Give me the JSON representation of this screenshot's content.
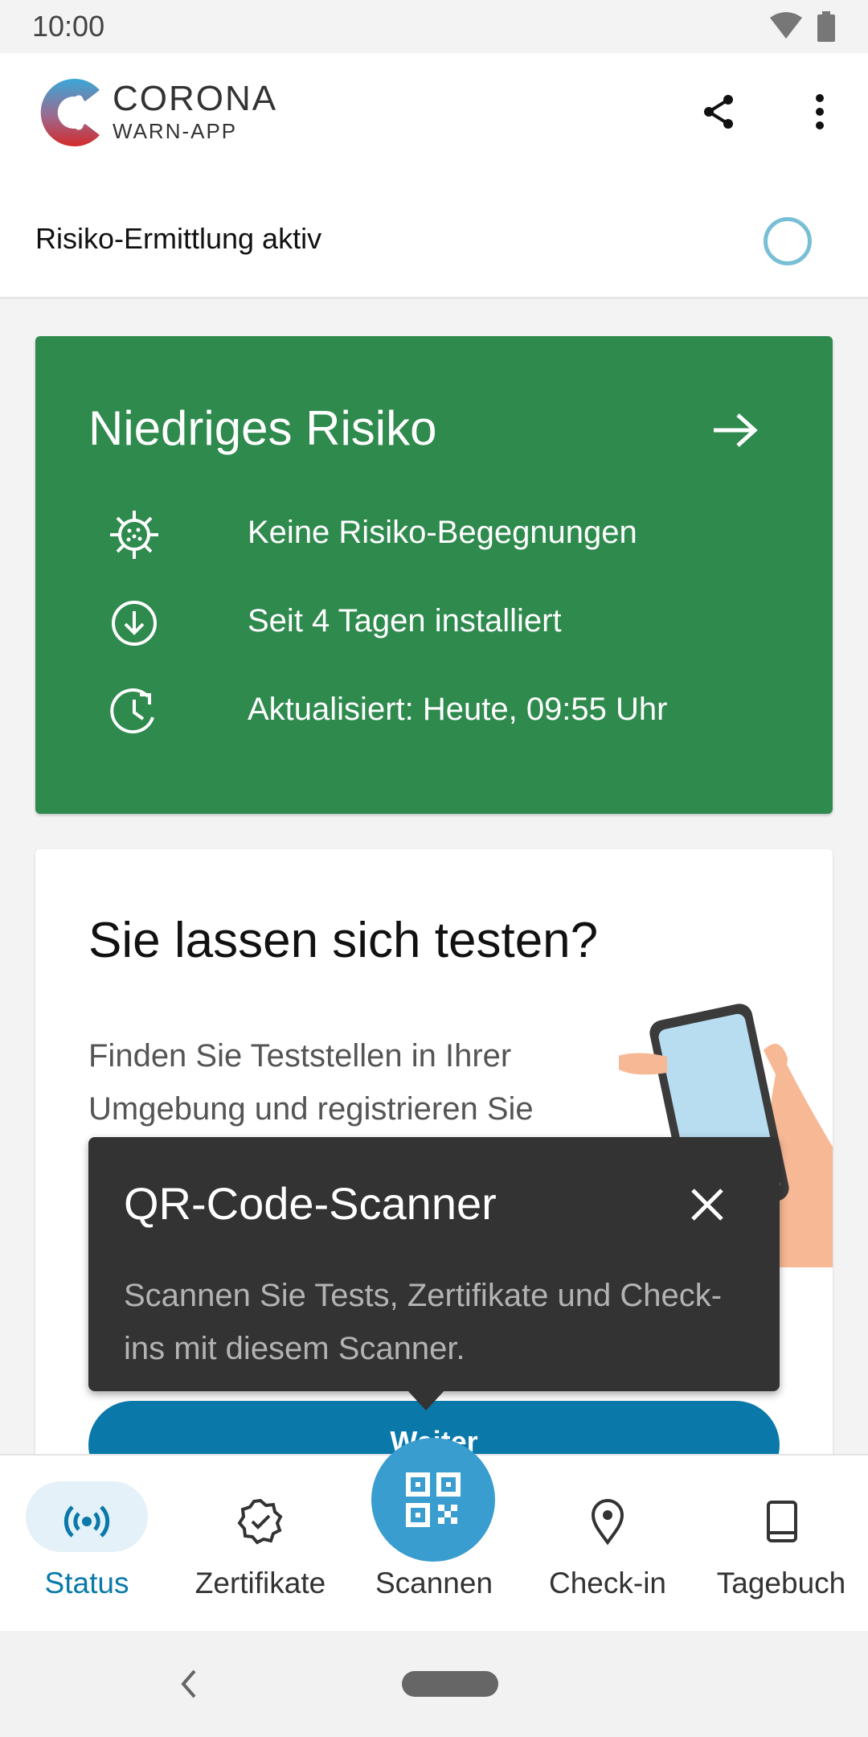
{
  "status_bar": {
    "time": "10:00"
  },
  "app_bar": {
    "logo_title": "CORONA",
    "logo_subtitle": "WARN-APP",
    "share_icon": "share-icon",
    "menu_icon": "more-vert-icon"
  },
  "tracing": {
    "label": "Risiko-Ermittlung aktiv"
  },
  "risk_card": {
    "title": "Niedriges Risiko",
    "color": "#2f8a4e",
    "lines": [
      {
        "icon": "virus-icon",
        "text": "Keine Risiko-Begegnungen"
      },
      {
        "icon": "download-icon",
        "text": "Seit 4 Tagen installiert"
      },
      {
        "icon": "clock-refresh-icon",
        "text": "Aktualisiert: Heute, 09:55 Uhr"
      }
    ]
  },
  "test_card": {
    "title": "Sie lassen sich testen?",
    "body": "Finden Sie Teststellen in Ihrer Umgebung und registrieren Sie",
    "button_label": "Weiter"
  },
  "tooltip": {
    "title": "QR-Code-Scanner",
    "text": "Scannen Sie Tests, Zertifikate und Check-ins mit diesem Scanner."
  },
  "bottom_nav": {
    "items": [
      {
        "label": "Status",
        "icon": "broadcast-icon",
        "active": true
      },
      {
        "label": "Zertifikate",
        "icon": "certificate-icon",
        "active": false
      },
      {
        "label": "Scannen",
        "icon": "qr-code-icon",
        "active": false
      },
      {
        "label": "Check-in",
        "icon": "location-pin-icon",
        "active": false
      },
      {
        "label": "Tagebuch",
        "icon": "book-icon",
        "active": false
      }
    ],
    "accent_color": "#0a79aa"
  }
}
